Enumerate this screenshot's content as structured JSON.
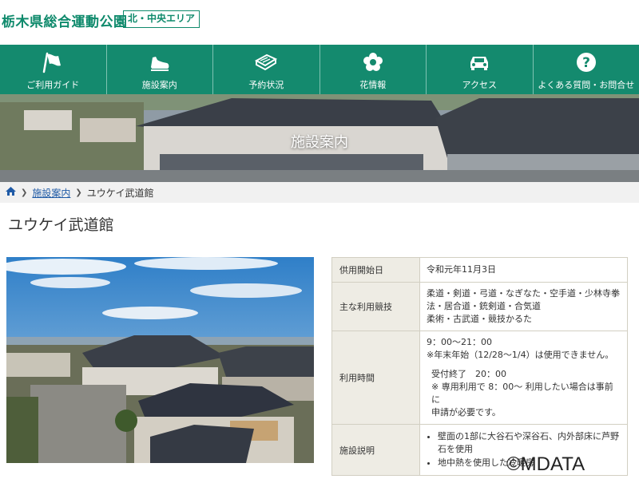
{
  "header": {
    "site_title": "栃木県総合運動公園",
    "area_badge": "北・中央エリア"
  },
  "nav": {
    "items": [
      {
        "label": "ご利用ガイド",
        "icon": "flag-icon"
      },
      {
        "label": "施設案内",
        "icon": "shoe-icon"
      },
      {
        "label": "予約状況",
        "icon": "book-icon"
      },
      {
        "label": "花情報",
        "icon": "flower-icon"
      },
      {
        "label": "アクセス",
        "icon": "car-icon"
      },
      {
        "label": "よくある質問・お問合せ",
        "icon": "question-icon"
      }
    ]
  },
  "hero": {
    "title": "施設案内"
  },
  "breadcrumb": {
    "home_icon": "home-icon",
    "link": "施設案内",
    "current": "ユウケイ武道館"
  },
  "page": {
    "title": "ユウケイ武道館"
  },
  "info": {
    "rows": [
      {
        "label": "供用開始日",
        "value": "令和元年11月3日"
      },
      {
        "label": "主な利用競技",
        "lines": [
          "柔道・剣道・弓道・なぎなた・空手道・少林寺拳",
          "法・居合道・銃剣道・合気道",
          "柔術・古武道・競技かるた"
        ]
      },
      {
        "label": "利用時間",
        "lines": [
          "9：00～21：00",
          "※年末年始（12/28～1/4）は使用できません。",
          "受付終了　20：00",
          "※ 専用利用で 8：00～ 利用したい場合は事前に",
          "申請が必要です。"
        ]
      },
      {
        "label": "施設説明",
        "bullets": [
          "壁面の1部に大谷石や深谷石、内外部床に芦野石を使用",
          "地中熱を使用した冷暖房"
        ]
      }
    ]
  },
  "watermark": "©MDATA",
  "colors": {
    "brand": "#148a6e",
    "link": "#1f5aa6"
  }
}
